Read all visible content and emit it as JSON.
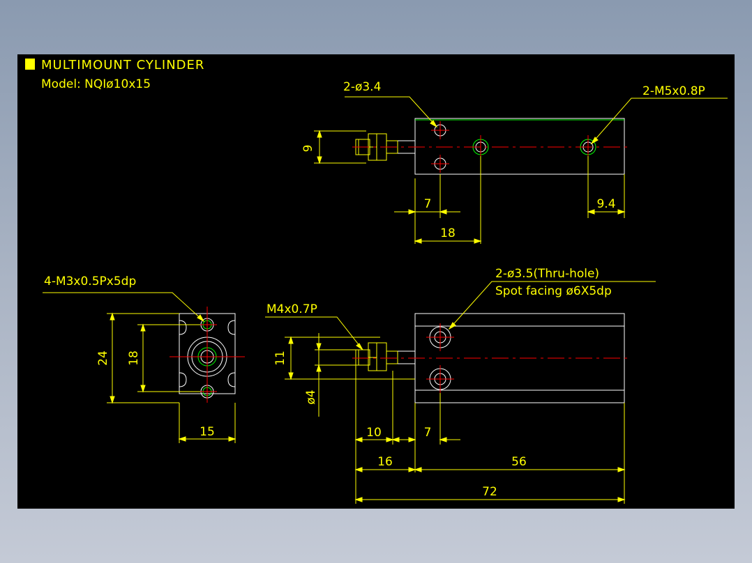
{
  "title": "MULTIMOUNT CYLINDER",
  "model": "Model: NQIø10x15",
  "colors": {
    "background": "#000000",
    "dimension": "#ffff00",
    "outline": "#ffffff",
    "centerline": "#ff0000",
    "part": "#00ff00"
  },
  "top_view": {
    "callout_holes": "2-ø3.4",
    "callout_ports": "2-M5x0.8P",
    "dim_height": "9",
    "dim_hole_offset": "7",
    "dim_port_offset": "9.4",
    "dim_port_from_end": "18"
  },
  "end_view": {
    "callout_taps": "4-M3x0.5Px5dp",
    "dim_height": "24",
    "dim_tap_pitch": "18",
    "dim_width": "15"
  },
  "side_view": {
    "callout_thru_1": "2-ø3.5(Thru-hole)",
    "callout_thru_2": "Spot facing ø6X5dp",
    "callout_rod_thread": "M4x0.7P",
    "dim_thread_length": "11",
    "dim_rod_dia": "ø4",
    "dim_rod_ext": "10",
    "dim_hole_offset": "7",
    "dim_rod_total": "16",
    "dim_body_length": "56",
    "dim_overall": "72"
  }
}
